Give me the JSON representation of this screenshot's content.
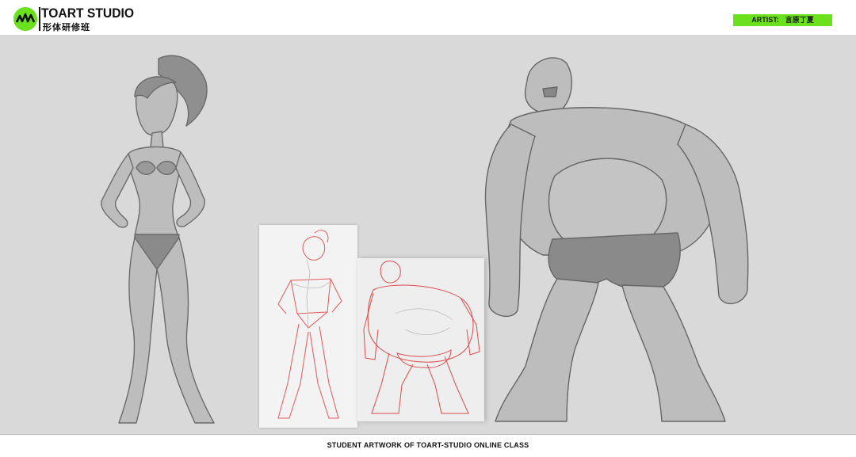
{
  "header": {
    "brand_title": "TOART STUDIO",
    "brand_subtitle": "形体研修班",
    "artist_label": "ARTIST:",
    "artist_name": "言原丁夏",
    "accent_color": "#6be11d"
  },
  "footer": {
    "caption": "STUDENT ARTWORK OF TOART-STUDIO ONLINE CLASS"
  },
  "artwork": {
    "figures": [
      "woman-figure",
      "ogre-figure"
    ],
    "sketch_panels": [
      "woman-sketch",
      "ogre-sketch"
    ]
  }
}
